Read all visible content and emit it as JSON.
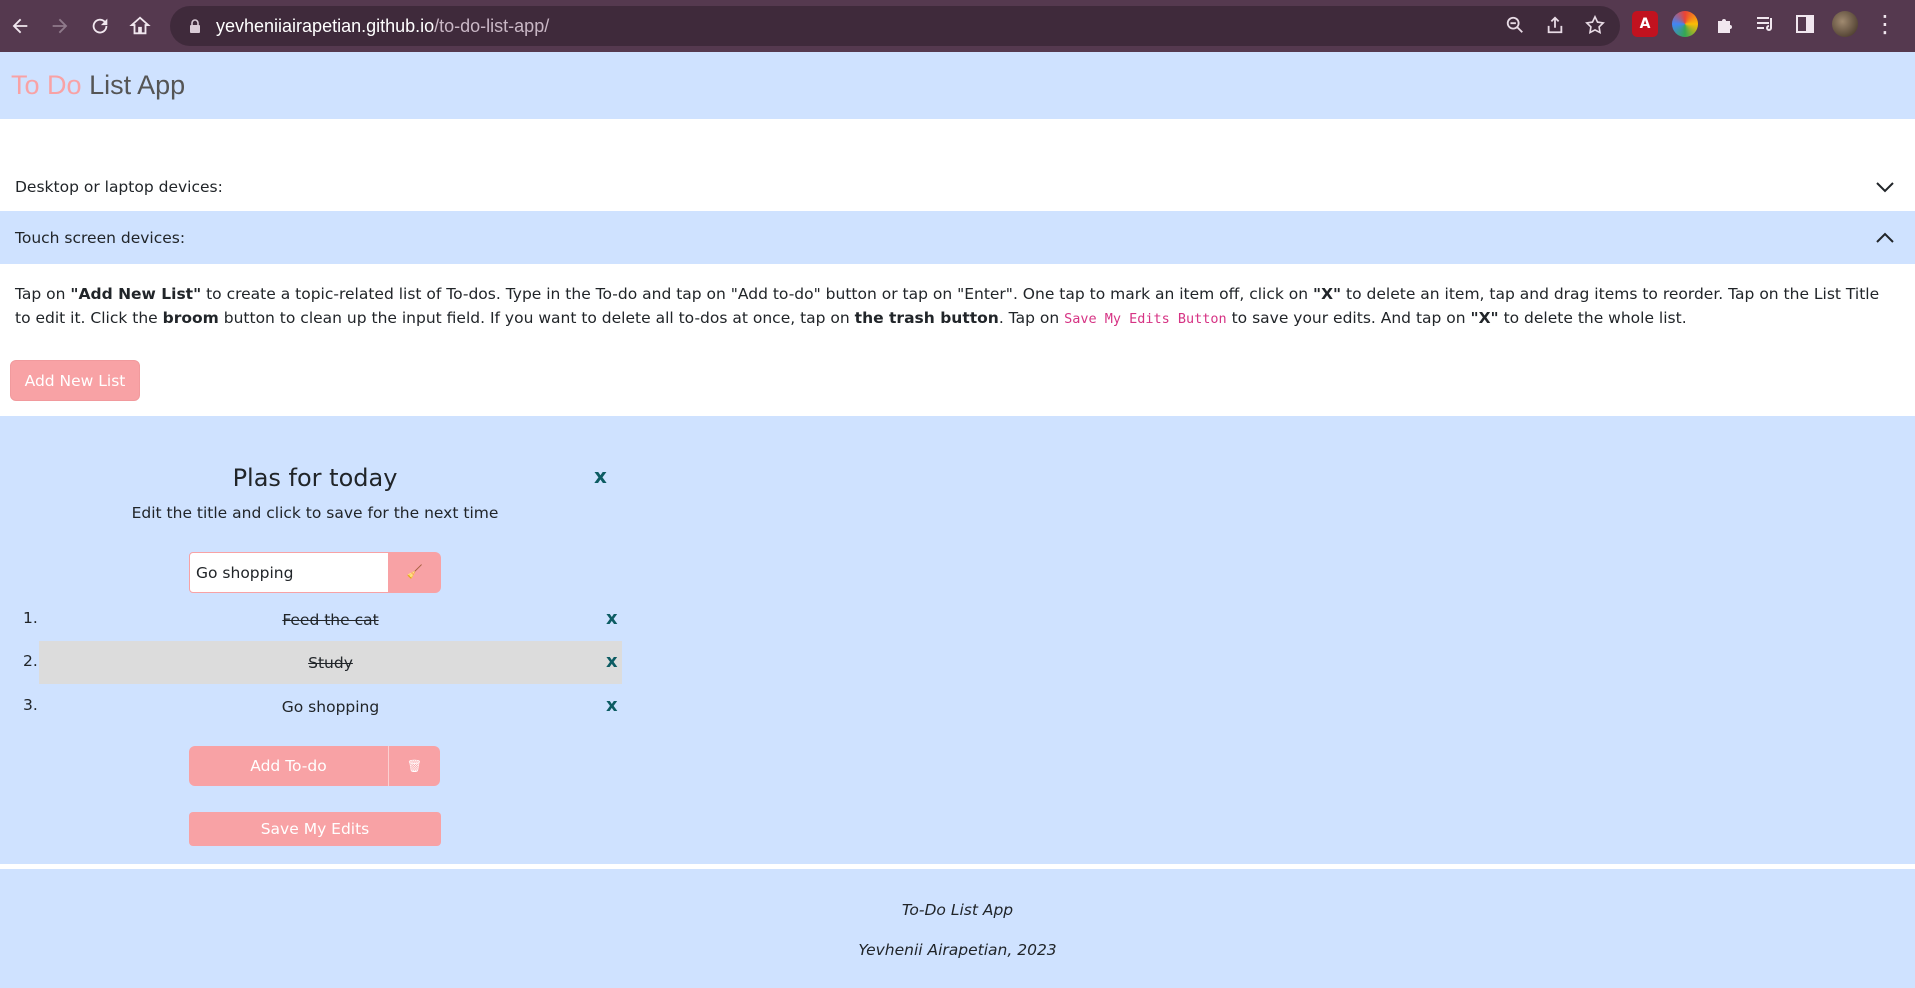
{
  "browser": {
    "url_host": "yevheniiairapetian.github.io",
    "url_path": "/to-do-list-app/",
    "icons": [
      "back-icon",
      "forward-icon",
      "reload-icon",
      "home-icon",
      "lock-icon",
      "zoom-icon",
      "share-icon",
      "star-icon",
      "pdf-extension-icon",
      "color-extension-icon",
      "puzzle-icon",
      "media-icon",
      "side-panel-icon",
      "avatar",
      "menu-icon"
    ]
  },
  "header": {
    "brand_part1": "To Do",
    "brand_part2": "List App"
  },
  "accordion": {
    "item1_label": "Desktop or laptop devices:",
    "item2_label": "Touch screen devices:",
    "body": {
      "t1": "Tap on ",
      "b1": "\"Add New List\"",
      "t2": " to create a topic-related list of To-dos. Type in the To-do and tap on \"Add to-do\" button or tap on \"Enter\". One tap to mark an item off, click on ",
      "b2": "\"X\"",
      "t3": " to delete an item, tap and drag items to reorder. Tap on the List Title to edit it. Click the ",
      "b3": "broom",
      "t4": " button to clean up the input field. If you want to delete all to-dos at once, tap on ",
      "b4": "the trash button",
      "t5": ". Tap on ",
      "code": "Save My Edits Button",
      "t6": " to save your edits. And tap on ",
      "b5": "\"X\"",
      "t7": " to delete the whole list."
    }
  },
  "add_list_button": "Add New List",
  "list": {
    "title": "Plas for today",
    "close": "x",
    "subtitle": "Edit the title and click to save for the next time",
    "input_value": "Go shopping",
    "broom_glyph": "🧹",
    "items": [
      {
        "num": "1.",
        "text": "Feed the cat",
        "done": true,
        "delete": "x"
      },
      {
        "num": "2.",
        "text": "Study",
        "done": true,
        "delete": "x"
      },
      {
        "num": "3.",
        "text": "Go shopping",
        "done": false,
        "delete": "x"
      }
    ],
    "add_todo_label": "Add To-do",
    "trash_glyph": "🗑",
    "save_label": "Save My Edits"
  },
  "footer": {
    "line1": "To-Do List App",
    "line2": "Yevhenii Airapetian, 2023"
  },
  "colors": {
    "chrome": "#55394f",
    "accent_pink": "#f8a2a5",
    "light_blue": "#cfe2ff",
    "close_teal": "#0d5c63"
  }
}
